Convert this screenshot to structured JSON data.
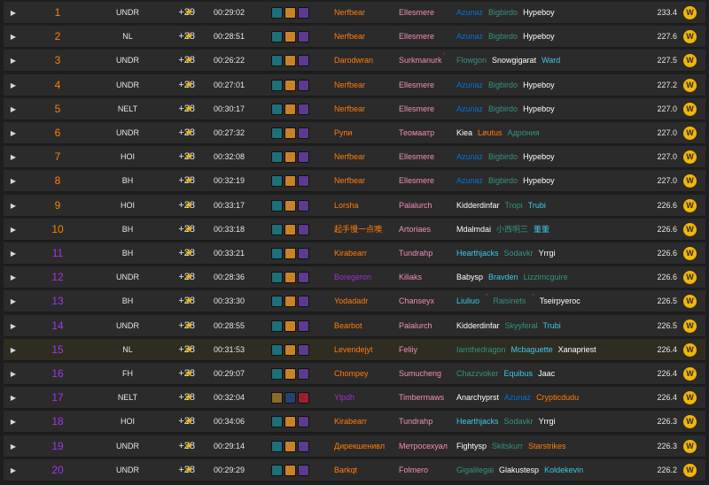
{
  "icons": {
    "expand": "▶",
    "star": "★",
    "badge": "W"
  },
  "colors": {
    "rank_orange": "#ff8000",
    "rank_purple": "#a335ee",
    "star": "#f2b705",
    "badge": "#f2b705",
    "row_bg": "#2b2b2b",
    "row_highlight_bg": "#2f2d22"
  },
  "rows": [
    {
      "rank": "1",
      "dungeon": "UNDR",
      "level": "+29",
      "time": "00:29:02",
      "affix_icons": [
        "fortified-icon",
        "incorporeal-icon",
        "spiteful-icon"
      ],
      "tank": "Nerfbear",
      "tank_class": "c-druid",
      "healer": "Ellesmere",
      "healer_class": "c-pal",
      "dps": [
        {
          "name": "Azunaz",
          "cls": "c-shaman"
        },
        {
          "name": "Bigbirdo",
          "cls": "c-evoker"
        },
        {
          "name": "Hypeboy",
          "cls": "c-white"
        }
      ],
      "score": "233.4",
      "rank_color": "c-orange"
    },
    {
      "rank": "2",
      "dungeon": "NL",
      "level": "+28",
      "time": "00:28:51",
      "affix_icons": [
        "fortified-icon",
        "incorporeal-icon",
        "spiteful-icon"
      ],
      "tank": "Nerfbear",
      "tank_class": "c-druid",
      "healer": "Ellesmere",
      "healer_class": "c-pal",
      "dps": [
        {
          "name": "Azunaz",
          "cls": "c-shaman"
        },
        {
          "name": "Bigbirdo",
          "cls": "c-evoker"
        },
        {
          "name": "Hypeboy",
          "cls": "c-white"
        }
      ],
      "score": "227.6",
      "rank_color": "c-orange"
    },
    {
      "rank": "3",
      "dungeon": "UNDR",
      "level": "+28",
      "time": "00:26:22",
      "affix_icons": [
        "fortified-icon",
        "incorporeal-icon",
        "spiteful-icon"
      ],
      "tank": "Darodwran",
      "tank_class": "c-druid",
      "healer": "Surkmanurk",
      "healer_class": "c-pal",
      "healer_sup": "*",
      "dps": [
        {
          "name": "Flowgon",
          "cls": "c-evoker"
        },
        {
          "name": "Snowgigarat",
          "cls": "c-white"
        },
        {
          "name": "Ward",
          "cls": "c-mage"
        }
      ],
      "score": "227.5",
      "rank_color": "c-orange"
    },
    {
      "rank": "4",
      "dungeon": "UNDR",
      "level": "+28",
      "time": "00:27:01",
      "affix_icons": [
        "fortified-icon",
        "incorporeal-icon",
        "spiteful-icon"
      ],
      "tank": "Nerfbear",
      "tank_class": "c-druid",
      "healer": "Ellesmere",
      "healer_class": "c-pal",
      "dps": [
        {
          "name": "Azunaz",
          "cls": "c-shaman"
        },
        {
          "name": "Bigbirdo",
          "cls": "c-evoker"
        },
        {
          "name": "Hypeboy",
          "cls": "c-white"
        }
      ],
      "score": "227.2",
      "rank_color": "c-orange"
    },
    {
      "rank": "5",
      "dungeon": "NELT",
      "level": "+28",
      "time": "00:30:17",
      "affix_icons": [
        "fortified-icon",
        "incorporeal-icon",
        "spiteful-icon"
      ],
      "tank": "Nerfbear",
      "tank_class": "c-druid",
      "healer": "Ellesmere",
      "healer_class": "c-pal",
      "dps": [
        {
          "name": "Azunaz",
          "cls": "c-shaman"
        },
        {
          "name": "Bigbirdo",
          "cls": "c-evoker"
        },
        {
          "name": "Hypeboy",
          "cls": "c-white"
        }
      ],
      "score": "227.0",
      "rank_color": "c-orange"
    },
    {
      "rank": "6",
      "dungeon": "UNDR",
      "level": "+28",
      "time": "00:27:32",
      "affix_icons": [
        "fortified-icon",
        "incorporeal-icon",
        "spiteful-icon"
      ],
      "tank": "Рупи",
      "tank_class": "c-druid",
      "healer": "Теомаатр",
      "healer_class": "c-pal",
      "dps": [
        {
          "name": "Kiea",
          "cls": "c-white"
        },
        {
          "name": "Løutus",
          "cls": "c-druid"
        },
        {
          "name": "Адрония",
          "cls": "c-evoker"
        }
      ],
      "score": "227.0",
      "rank_color": "c-orange"
    },
    {
      "rank": "7",
      "dungeon": "HOI",
      "level": "+28",
      "time": "00:32:08",
      "affix_icons": [
        "fortified-icon",
        "incorporeal-icon",
        "spiteful-icon"
      ],
      "tank": "Nerfbear",
      "tank_class": "c-druid",
      "healer": "Ellesmere",
      "healer_class": "c-pal",
      "dps": [
        {
          "name": "Azunaz",
          "cls": "c-shaman"
        },
        {
          "name": "Bigbirdo",
          "cls": "c-evoker"
        },
        {
          "name": "Hypeboy",
          "cls": "c-white"
        }
      ],
      "score": "227.0",
      "rank_color": "c-orange"
    },
    {
      "rank": "8",
      "dungeon": "BH",
      "level": "+28",
      "time": "00:32:19",
      "affix_icons": [
        "fortified-icon",
        "incorporeal-icon",
        "spiteful-icon"
      ],
      "tank": "Nerfbear",
      "tank_class": "c-druid",
      "healer": "Ellesmere",
      "healer_class": "c-pal",
      "dps": [
        {
          "name": "Azunaz",
          "cls": "c-shaman"
        },
        {
          "name": "Bigbirdo",
          "cls": "c-evoker"
        },
        {
          "name": "Hypeboy",
          "cls": "c-white"
        }
      ],
      "score": "227.0",
      "rank_color": "c-orange"
    },
    {
      "rank": "9",
      "dungeon": "HOI",
      "level": "+28",
      "time": "00:33:17",
      "affix_icons": [
        "fortified-icon",
        "incorporeal-icon",
        "spiteful-icon"
      ],
      "tank": "Lorsha",
      "tank_class": "c-druid",
      "healer": "Palalurch",
      "healer_class": "c-pal",
      "dps": [
        {
          "name": "Kidderdinfar",
          "cls": "c-white"
        },
        {
          "name": "Tropi",
          "cls": "c-evoker"
        },
        {
          "name": "Trubi",
          "cls": "c-mage"
        }
      ],
      "score": "226.6",
      "rank_color": "c-orange"
    },
    {
      "rank": "10",
      "dungeon": "BH",
      "level": "+28",
      "time": "00:33:18",
      "affix_icons": [
        "fortified-icon",
        "incorporeal-icon",
        "spiteful-icon"
      ],
      "tank": "起手慢一点噢",
      "tank_class": "c-druid",
      "healer": "Artoriaes",
      "healer_class": "c-pal",
      "dps": [
        {
          "name": "Mdalmdai",
          "cls": "c-white"
        },
        {
          "name": "小西明三",
          "cls": "c-evoker"
        },
        {
          "name": "董董",
          "cls": "c-mage"
        }
      ],
      "score": "226.6",
      "rank_color": "c-orange"
    },
    {
      "rank": "11",
      "dungeon": "BH",
      "level": "+28",
      "time": "00:33:21",
      "affix_icons": [
        "fortified-icon",
        "incorporeal-icon",
        "spiteful-icon"
      ],
      "tank": "Kirabearr",
      "tank_class": "c-druid",
      "healer": "Tundrahp",
      "healer_class": "c-pal",
      "dps": [
        {
          "name": "Hearthjacks",
          "cls": "c-mage"
        },
        {
          "name": "Sodavkr",
          "cls": "c-evoker"
        },
        {
          "name": "Yrrgi",
          "cls": "c-white"
        }
      ],
      "score": "226.6",
      "rank_color": "c-purple"
    },
    {
      "rank": "12",
      "dungeon": "UNDR",
      "level": "+28",
      "time": "00:28:36",
      "affix_icons": [
        "fortified-icon",
        "incorporeal-icon",
        "spiteful-icon"
      ],
      "tank": "Boregeron",
      "tank_class": "c-dh",
      "healer": "Kiliaks",
      "healer_class": "c-pal",
      "dps": [
        {
          "name": "Babysp",
          "cls": "c-white"
        },
        {
          "name": "Bravden",
          "cls": "c-mage"
        },
        {
          "name": "Lizzimcguire",
          "cls": "c-evoker"
        }
      ],
      "score": "226.6",
      "rank_color": "c-purple"
    },
    {
      "rank": "13",
      "dungeon": "BH",
      "level": "+28",
      "time": "00:33:30",
      "affix_icons": [
        "fortified-icon",
        "incorporeal-icon",
        "spiteful-icon"
      ],
      "tank": "Yodadadr",
      "tank_class": "c-druid",
      "healer": "Chanseyx",
      "healer_class": "c-pal",
      "dps": [
        {
          "name": "Liuliuo",
          "cls": "c-mage",
          "sup": "*"
        },
        {
          "name": "Raisinets",
          "cls": "c-evoker",
          "sup": "*"
        },
        {
          "name": "Tseirpyeroc",
          "cls": "c-white"
        }
      ],
      "score": "226.5",
      "rank_color": "c-purple"
    },
    {
      "rank": "14",
      "dungeon": "UNDR",
      "level": "+28",
      "time": "00:28:55",
      "affix_icons": [
        "fortified-icon",
        "incorporeal-icon",
        "spiteful-icon"
      ],
      "tank": "Bearbot",
      "tank_class": "c-druid",
      "healer": "Palalurch",
      "healer_class": "c-pal",
      "dps": [
        {
          "name": "Kidderdinfar",
          "cls": "c-white"
        },
        {
          "name": "Skyyferal",
          "cls": "c-evoker"
        },
        {
          "name": "Trubi",
          "cls": "c-mage"
        }
      ],
      "score": "226.5",
      "rank_color": "c-purple"
    },
    {
      "rank": "15",
      "dungeon": "NL",
      "level": "+28",
      "time": "00:31:53",
      "affix_icons": [
        "fortified-icon",
        "incorporeal-icon",
        "spiteful-icon"
      ],
      "tank": "Levendejyt",
      "tank_class": "c-druid",
      "healer": "Feliiy",
      "healer_class": "c-pal",
      "dps": [
        {
          "name": "Iamthedragon",
          "cls": "c-evoker"
        },
        {
          "name": "Mcbaguette",
          "cls": "c-mage"
        },
        {
          "name": "Xanapriest",
          "cls": "c-white"
        }
      ],
      "score": "226.4",
      "rank_color": "c-purple",
      "highlight": true
    },
    {
      "rank": "16",
      "dungeon": "FH",
      "level": "+28",
      "time": "00:29:07",
      "affix_icons": [
        "fortified-icon",
        "incorporeal-icon",
        "spiteful-icon"
      ],
      "tank": "Chompey",
      "tank_class": "c-druid",
      "healer": "Sumucheng",
      "healer_class": "c-pal",
      "dps": [
        {
          "name": "Chazzvoker",
          "cls": "c-evoker"
        },
        {
          "name": "Equibus",
          "cls": "c-mage"
        },
        {
          "name": "Jaac",
          "cls": "c-white"
        }
      ],
      "score": "226.4",
      "rank_color": "c-purple"
    },
    {
      "rank": "17",
      "dungeon": "NELT",
      "level": "+28",
      "time": "00:32:04",
      "affix_icons": [
        "tyrannical-icon",
        "storming-icon",
        "bolstering-icon"
      ],
      "alt_affix": true,
      "tank": "Ylpdh",
      "tank_class": "c-dh",
      "healer": "Timbermaws",
      "healer_class": "c-pal",
      "dps": [
        {
          "name": "Anarchyprst",
          "cls": "c-white"
        },
        {
          "name": "Azunaz",
          "cls": "c-shaman"
        },
        {
          "name": "Crypticdudu",
          "cls": "c-druid"
        }
      ],
      "score": "226.4",
      "rank_color": "c-purple"
    },
    {
      "rank": "18",
      "dungeon": "HOI",
      "level": "+28",
      "time": "00:34:06",
      "affix_icons": [
        "fortified-icon",
        "incorporeal-icon",
        "spiteful-icon"
      ],
      "tank": "Kirabearr",
      "tank_class": "c-druid",
      "healer": "Tundrahp",
      "healer_class": "c-pal",
      "dps": [
        {
          "name": "Hearthjacks",
          "cls": "c-mage"
        },
        {
          "name": "Sodavkr",
          "cls": "c-evoker"
        },
        {
          "name": "Yrrgi",
          "cls": "c-white"
        }
      ],
      "score": "226.3",
      "rank_color": "c-purple"
    },
    {
      "rank": "19",
      "dungeon": "UNDR",
      "level": "+28",
      "time": "00:29:14",
      "affix_icons": [
        "fortified-icon",
        "incorporeal-icon",
        "spiteful-icon"
      ],
      "tank": "Дирекшенивл",
      "tank_class": "c-druid",
      "healer": "Метросехуал",
      "healer_class": "c-pal",
      "dps": [
        {
          "name": "Fightysp",
          "cls": "c-white"
        },
        {
          "name": "Skitskurr",
          "cls": "c-evoker"
        },
        {
          "name": "Starstrikes",
          "cls": "c-druid"
        }
      ],
      "score": "226.3",
      "rank_color": "c-purple"
    },
    {
      "rank": "20",
      "dungeon": "UNDR",
      "level": "+28",
      "time": "00:29:29",
      "affix_icons": [
        "fortified-icon",
        "incorporeal-icon",
        "spiteful-icon"
      ],
      "tank": "Barkqt",
      "tank_class": "c-druid",
      "healer": "Folmero",
      "healer_class": "c-pal",
      "dps": [
        {
          "name": "Gigalilegai",
          "cls": "c-evoker"
        },
        {
          "name": "Glakustesp",
          "cls": "c-white"
        },
        {
          "name": "Koldekevin",
          "cls": "c-mage"
        }
      ],
      "score": "226.2",
      "rank_color": "c-purple"
    }
  ]
}
